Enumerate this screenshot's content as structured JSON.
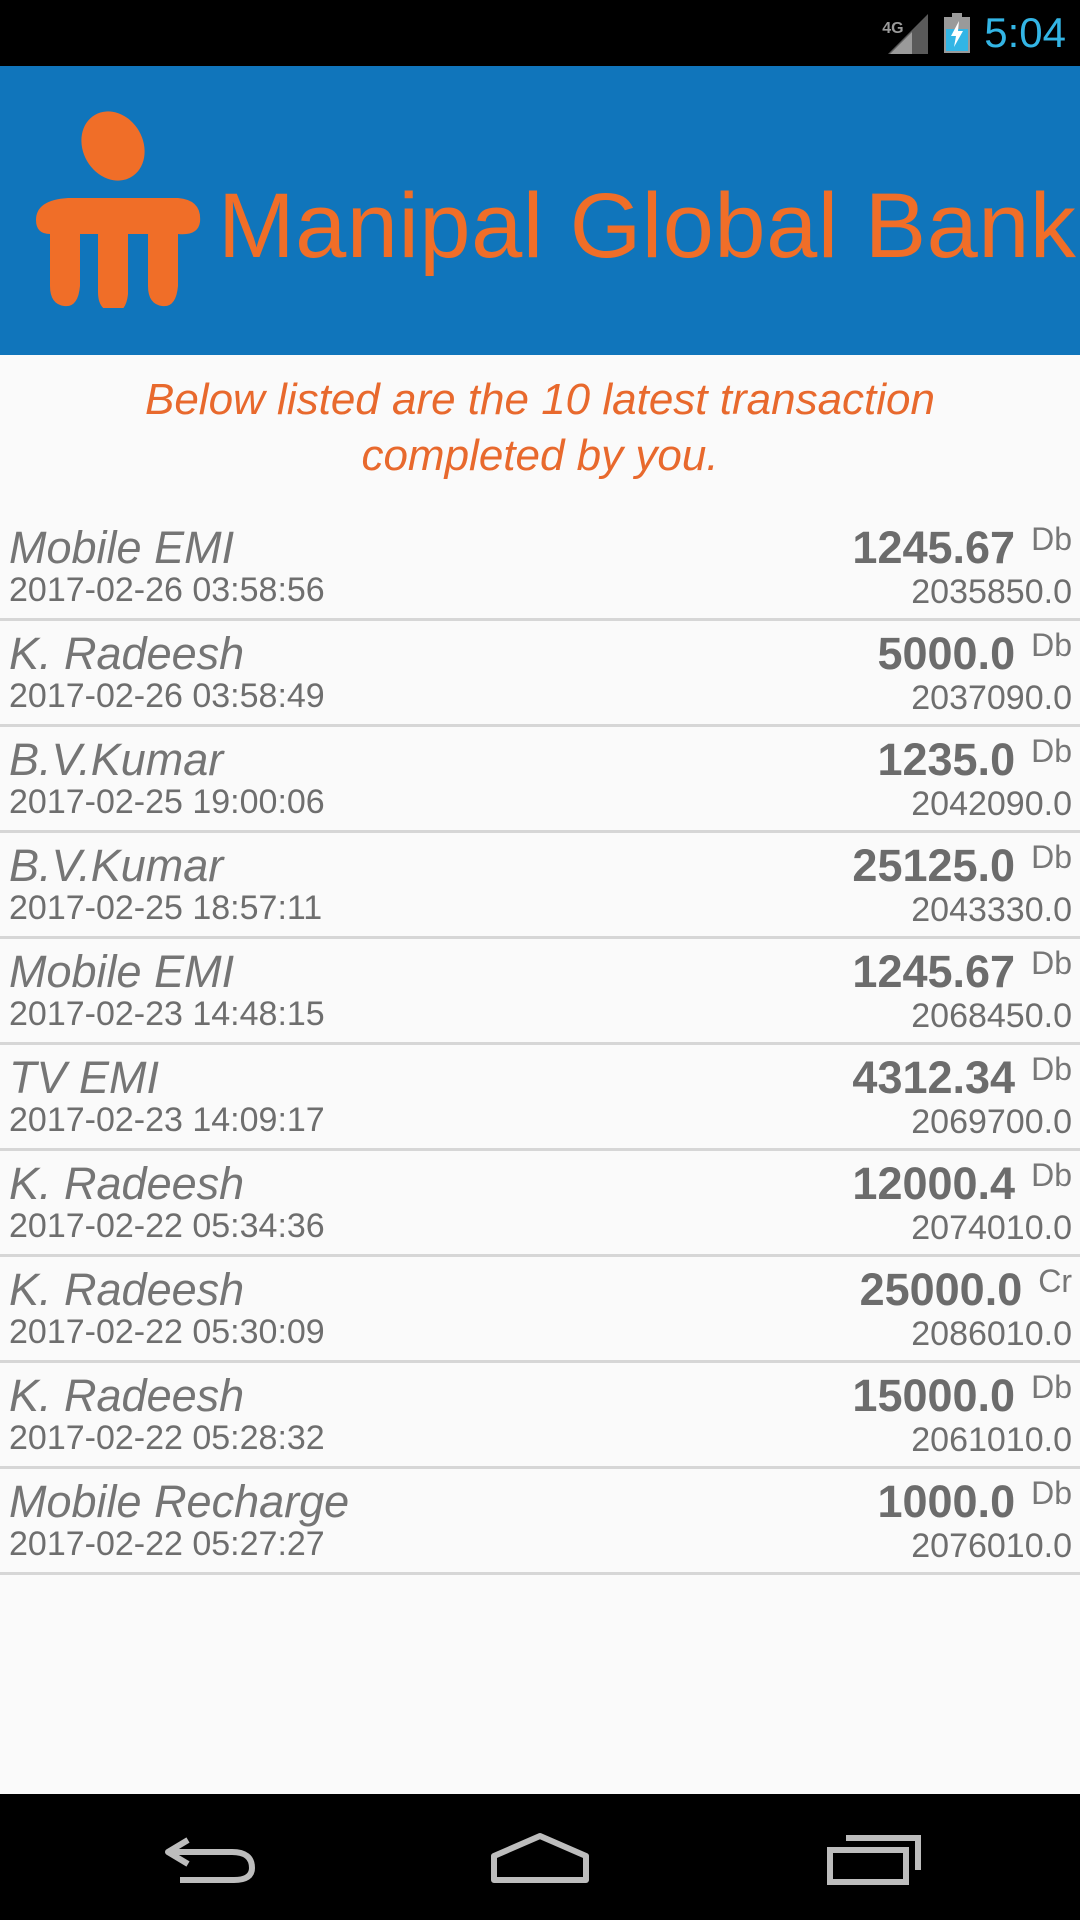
{
  "status_bar": {
    "network_label": "4G",
    "time": "5:04",
    "signal_icon": "signal-icon",
    "battery_icon": "battery-charging-icon"
  },
  "header": {
    "logo_icon": "manipal-logo",
    "bank_name": "Manipal Global Bank",
    "background": "#1075bb",
    "accent": "#f06e28"
  },
  "intro_text": "Below listed are the 10 latest transaction completed by you.",
  "transactions": [
    {
      "name": "Mobile EMI",
      "datetime": "2017-02-26 03:58:56",
      "amount": "1245.67",
      "type": "Db",
      "balance": "2035850.0"
    },
    {
      "name": "K. Radeesh",
      "datetime": "2017-02-26 03:58:49",
      "amount": "5000.0",
      "type": "Db",
      "balance": "2037090.0"
    },
    {
      "name": "B.V.Kumar",
      "datetime": "2017-02-25 19:00:06",
      "amount": "1235.0",
      "type": "Db",
      "balance": "2042090.0"
    },
    {
      "name": "B.V.Kumar",
      "datetime": "2017-02-25 18:57:11",
      "amount": "25125.0",
      "type": "Db",
      "balance": "2043330.0"
    },
    {
      "name": "Mobile EMI",
      "datetime": "2017-02-23 14:48:15",
      "amount": "1245.67",
      "type": "Db",
      "balance": "2068450.0"
    },
    {
      "name": "TV EMI",
      "datetime": "2017-02-23 14:09:17",
      "amount": "4312.34",
      "type": "Db",
      "balance": "2069700.0"
    },
    {
      "name": "K. Radeesh",
      "datetime": "2017-02-22 05:34:36",
      "amount": "12000.4",
      "type": "Db",
      "balance": "2074010.0"
    },
    {
      "name": "K. Radeesh",
      "datetime": "2017-02-22 05:30:09",
      "amount": "25000.0",
      "type": "Cr",
      "balance": "2086010.0"
    },
    {
      "name": "K. Radeesh",
      "datetime": "2017-02-22 05:28:32",
      "amount": "15000.0",
      "type": "Db",
      "balance": "2061010.0"
    },
    {
      "name": "Mobile Recharge",
      "datetime": "2017-02-22 05:27:27",
      "amount": "1000.0",
      "type": "Db",
      "balance": "2076010.0"
    }
  ],
  "nav_bar": {
    "back_icon": "back-icon",
    "home_icon": "home-icon",
    "recents_icon": "recents-icon"
  }
}
